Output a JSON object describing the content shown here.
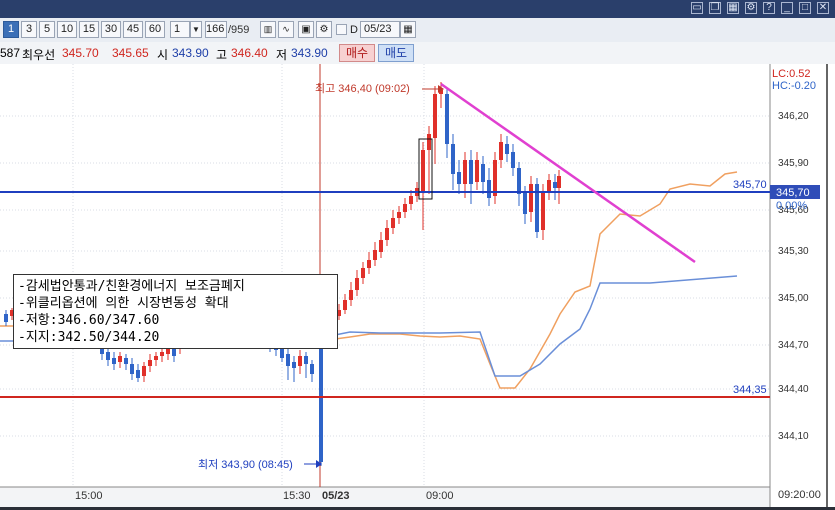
{
  "toolbar": {
    "intervals": [
      "1",
      "3",
      "5",
      "10",
      "15",
      "30",
      "45",
      "60"
    ],
    "active_interval": "1",
    "multiplier": "1",
    "count": "166",
    "total": "/959",
    "date": "05/23",
    "d_label": "D"
  },
  "quote": {
    "code": "587",
    "best_label": "최우선",
    "ask": "345.70",
    "bid": "345.65",
    "open_label": "시",
    "open": "343.90",
    "high_label": "고",
    "high": "346.40",
    "low_label": "저",
    "low": "343.90",
    "buy": "매수",
    "sell": "매도"
  },
  "chart": {
    "price_labels": [
      "346,20",
      "345,90",
      "345,60",
      "345,30",
      "345,00",
      "344,70",
      "344,40",
      "344,10"
    ],
    "lc": "LC:0.52",
    "hc": "HC:-0.20",
    "hline_blue": "345,70",
    "hline_blue_right": "345,70",
    "pct": "0.00%",
    "hline_red": "344,35",
    "high_annot": "최고 346,40 (09:02)",
    "low_annot": "최저 343,90 (08:45)",
    "time_labels": [
      "15:00",
      "15:30",
      "05/23",
      "09:00"
    ],
    "current_time": "09:20:00"
  },
  "note": {
    "line1": "-감세법안통과/친환경에너지 보조금폐지",
    "line2": "-위클리옵션에 의한 시장변동성 확대",
    "line3": "-저항:346.60/347.60",
    "line4": "-지지:342.50/344.20"
  },
  "colors": {
    "up": "#e0302a",
    "down": "#2f64c8",
    "blue_line": "#1f3fbf",
    "red_line": "#d0261f",
    "trend": "#e040d0",
    "ma_orange": "#f0a060",
    "ma_blue": "#6a8fd8"
  }
}
